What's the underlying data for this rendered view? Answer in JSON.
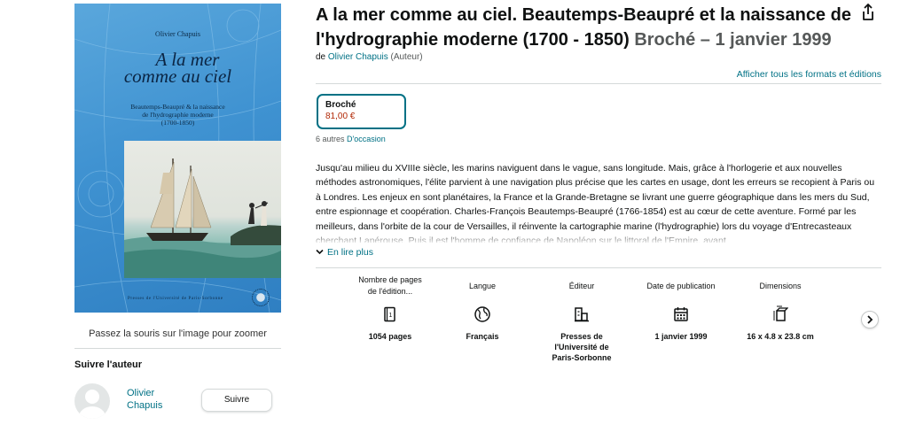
{
  "cover": {
    "author": "Olivier Chapuis",
    "title_line1": "A la mer",
    "title_line2": "comme au ciel",
    "subtitle_line1": "Beautemps-Beaupré & la naissance",
    "subtitle_line2": "de l'hydrographie moderne",
    "subtitle_line3": "(1700-1850)",
    "publisher": "Presses de l'Université de Paris-Sorbonne"
  },
  "image_hint": "Passez la souris sur l'image pour zoomer",
  "follow": {
    "heading": "Suivre l'auteur",
    "author_name": "Olivier Chapuis",
    "button": "Suivre"
  },
  "product": {
    "title": "A la mer comme au ciel. Beautemps-Beaupré et la naissance de l'hydrographie moderne (1700 - 1850)",
    "format_date": "Broché – 1 janvier 1999",
    "by": "de",
    "author": "Olivier Chapuis",
    "author_role": "(Auteur)",
    "all_formats": "Afficher tous les formats et éditions"
  },
  "format_option": {
    "name": "Broché",
    "price": "81,00 €"
  },
  "used": {
    "count_text": "6 autres",
    "link": "D'occasion"
  },
  "description": "Jusqu'au milieu du XVIIIe siècle, les marins naviguent dans le vague, sans longitude. Mais, grâce à l'horlogerie et aux nouvelles méthodes astronomiques, l'élite parvient à une navigation plus précise que les cartes en usage, dont les erreurs se recopient à Paris ou à Londres. Les enjeux en sont planétaires, la France et la Grande-Bretagne se livrant une guerre géographique dans les mers du Sud, entre espionnage et coopération. Charles-François Beautemps-Beaupré (1766-1854) est au cœur de cette aventure. Formé par les meilleurs, dans l'orbite de la cour de Versailles, il réinvente la cartographie marine (l'hydrographie) lors du voyage d'Entrecasteaux cherchant Lapérouse. Puis il est l'homme de confiance de Napoléon sur le littoral de l'Empire, avant",
  "read_more": "En lire plus",
  "details": {
    "pages_label": "Nombre de pages de l'édition...",
    "pages_label_line1": "Nombre de pages",
    "pages_label_line2": "de l'édition...",
    "pages_value": "1054 pages",
    "language_label": "Langue",
    "language_value": "Français",
    "publisher_label": "Éditeur",
    "publisher_line1": "Presses de",
    "publisher_line2": "l'Université de",
    "publisher_line3": "Paris-Sorbonne",
    "date_label": "Date de publication",
    "date_value": "1 janvier 1999",
    "dimensions_label": "Dimensions",
    "dimensions_value": "16 x 4.8 x 23.8 cm"
  },
  "colors": {
    "link": "#007185",
    "price": "#b12704",
    "cover_blue": "#3f92d1"
  }
}
